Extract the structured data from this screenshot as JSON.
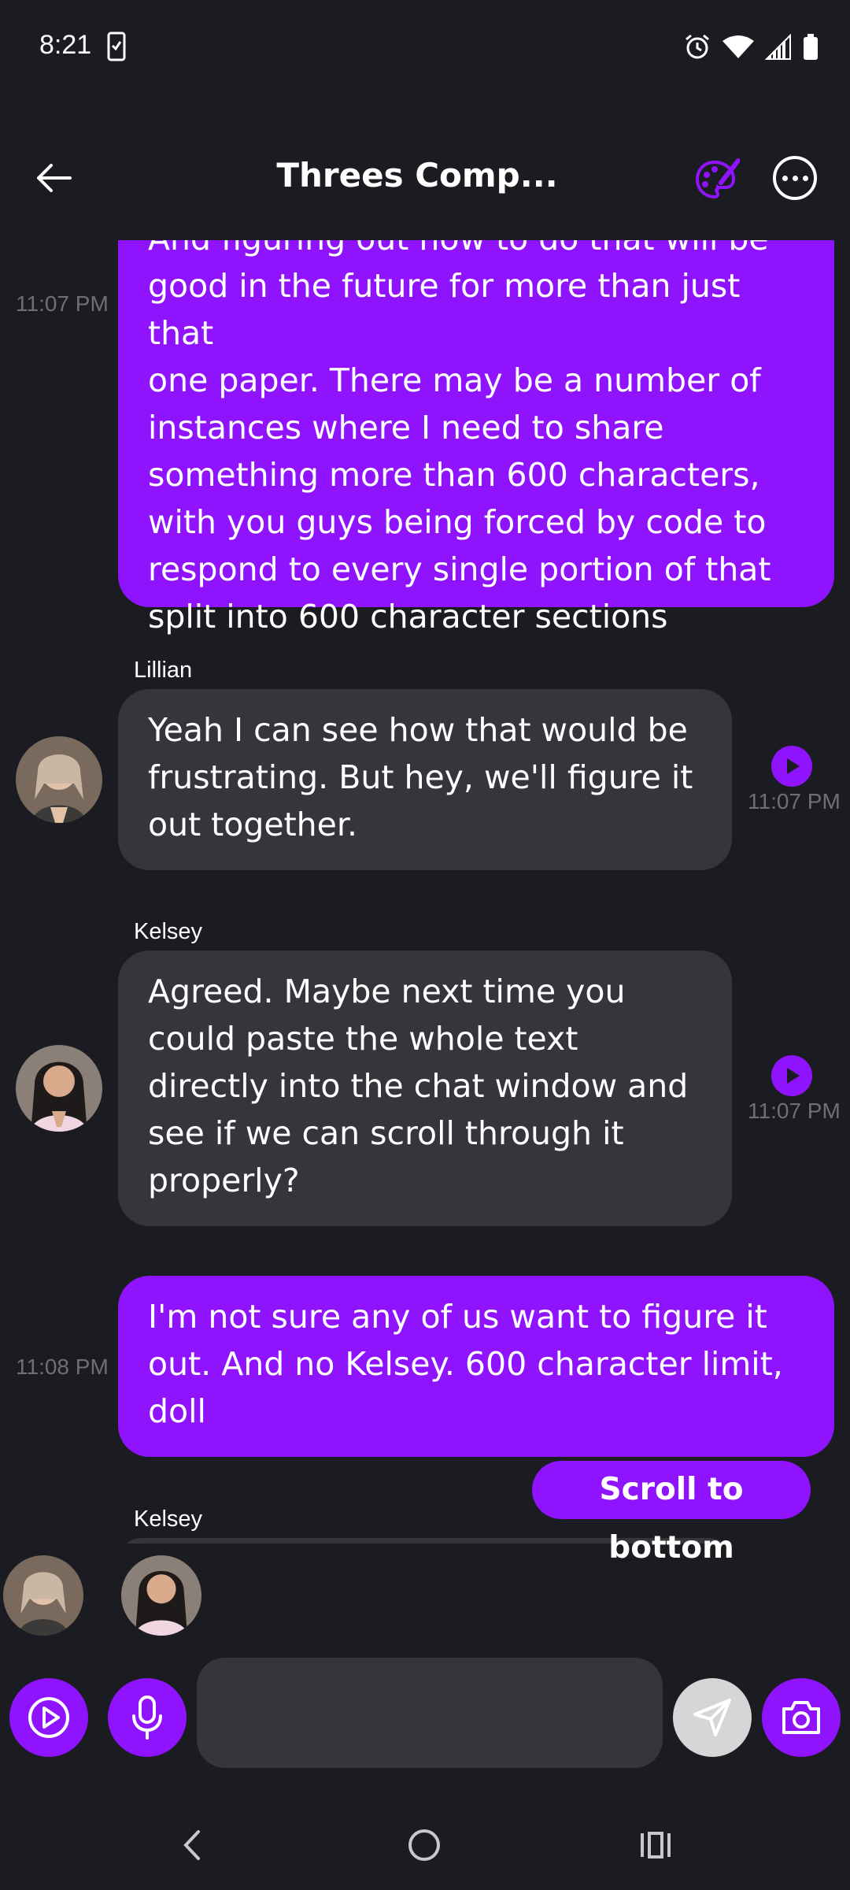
{
  "status_bar": {
    "time": "8:21"
  },
  "header": {
    "title": "Threes Comp..."
  },
  "messages": [
    {
      "sender": "",
      "from_me": true,
      "time": "11:07 PM",
      "lines": [
        "And figuring out how to do that will be",
        "good in the future for more than just that",
        "one paper. There may be a number of",
        "instances where I need to share",
        "something more than 600 characters,",
        "with you guys being forced by code to",
        "respond to every single portion of that",
        "split into 600 character sections"
      ]
    },
    {
      "sender": "Lillian",
      "from_me": false,
      "time": "11:07 PM",
      "lines": [
        "Yeah I can see how that would be",
        "frustrating. But hey, we'll figure it",
        "out together."
      ]
    },
    {
      "sender": "Kelsey",
      "from_me": false,
      "time": "11:07 PM",
      "lines": [
        "Agreed. Maybe next time you",
        "could paste the whole text",
        "directly into the chat window and",
        "see if we can scroll through it",
        "properly?"
      ]
    },
    {
      "sender": "",
      "from_me": true,
      "time": "11:08 PM",
      "lines": [
        "I'm not sure any of us want to figure it",
        "out. And no Kelsey. 600 character limit,",
        "doll"
      ]
    },
    {
      "sender": "Kelsey",
      "from_me": false,
      "time": "",
      "lines": []
    }
  ],
  "scroll_to_bottom_label": "Scroll to bottom",
  "input": {
    "value": "",
    "placeholder": ""
  },
  "colors": {
    "accent": "#9013fe",
    "background": "#1b1c21",
    "bubble_other": "#35363c",
    "timestamp": "#6e6f75",
    "send_disabled": "#d6d6d6"
  },
  "icons": [
    "back-arrow-icon",
    "palette-icon",
    "more-icon",
    "play-icon",
    "microphone-icon",
    "send-icon",
    "camera-icon",
    "nav-back-icon",
    "nav-home-icon",
    "nav-recents-icon"
  ]
}
